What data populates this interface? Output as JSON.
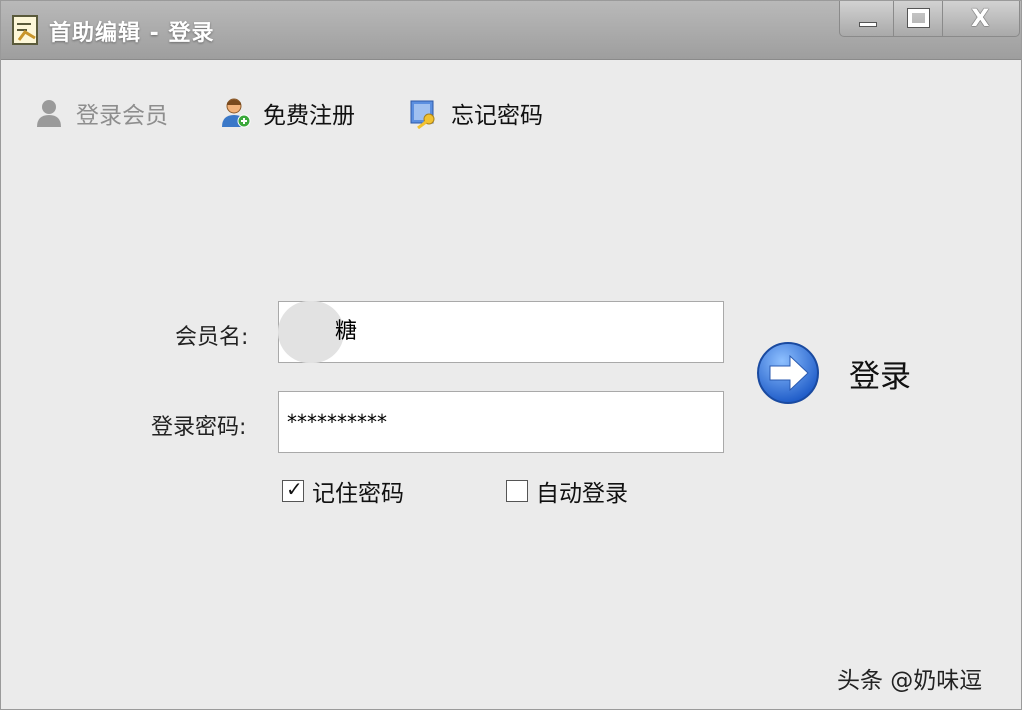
{
  "window": {
    "title": "首助编辑 - 登录",
    "controls": {
      "minimize_icon": "minimize-icon",
      "maximize_icon": "maximize-icon",
      "close_glyph": "X"
    }
  },
  "toolbar": {
    "items": [
      {
        "label": "登录会员",
        "icon": "member-login-icon",
        "enabled": false
      },
      {
        "label": "免费注册",
        "icon": "add-user-icon",
        "enabled": true
      },
      {
        "label": "忘记密码",
        "icon": "key-note-icon",
        "enabled": true
      }
    ]
  },
  "form": {
    "username_label": "会员名:",
    "username_value": "糖",
    "password_label": "登录密码:",
    "password_value": "**********",
    "remember_label": "记住密码",
    "remember_checked": true,
    "auto_login_label": "自动登录",
    "auto_login_checked": false
  },
  "login": {
    "label": "登录",
    "icon": "arrow-right-icon"
  },
  "watermark": "头条 @奶味逗",
  "colors": {
    "titlebar": "#a8a8a8",
    "window_bg": "#ebebeb",
    "arrow_blue": "#2e6fd6"
  }
}
